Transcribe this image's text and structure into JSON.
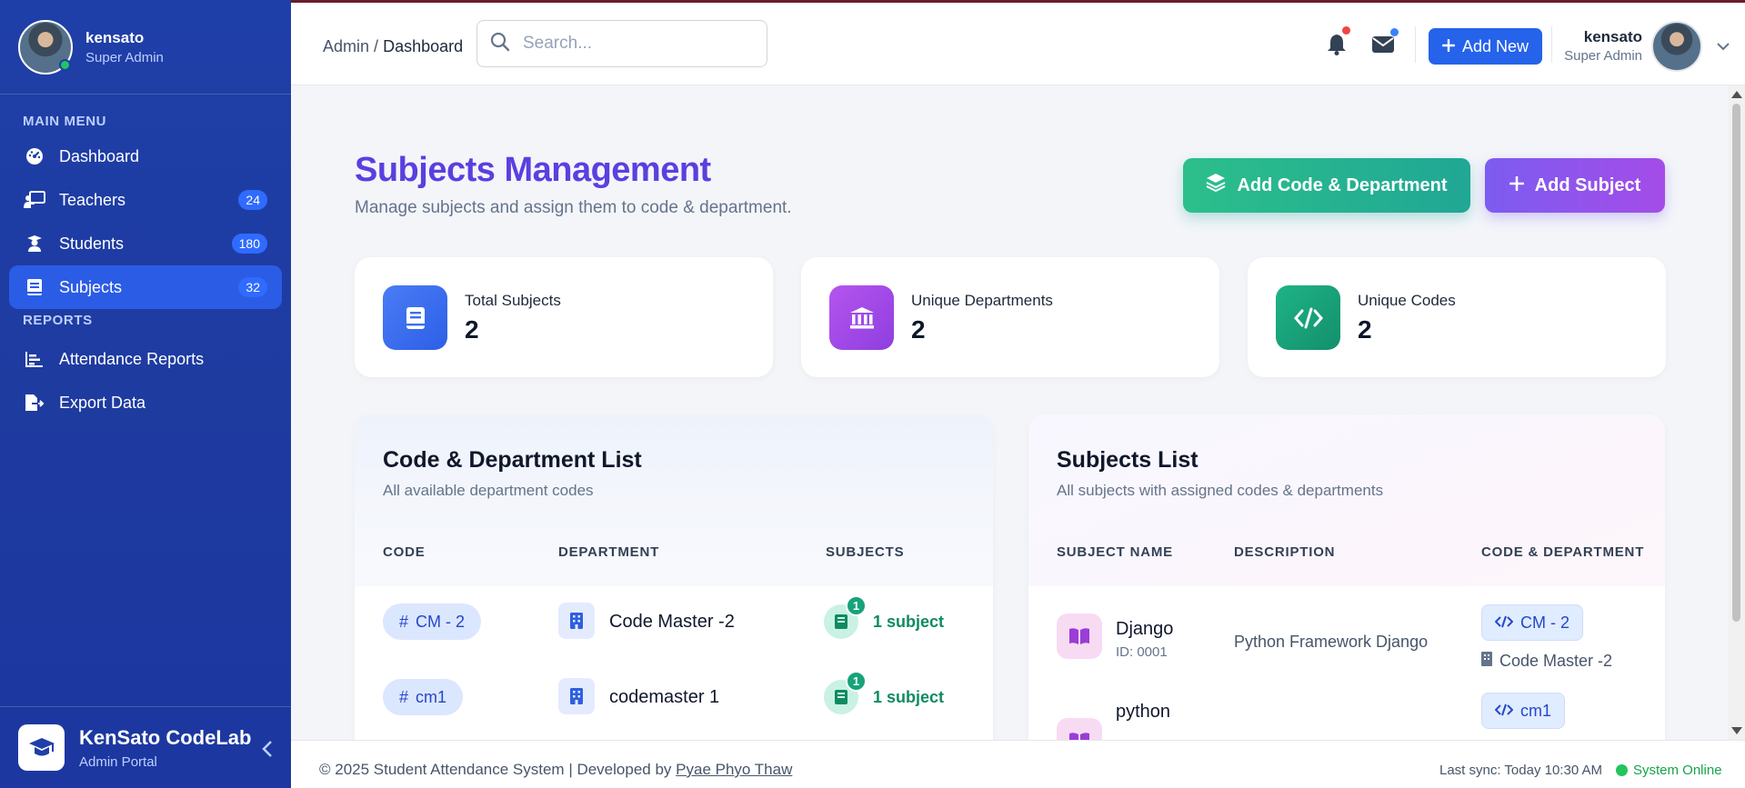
{
  "sidebar": {
    "user": {
      "name": "kensato",
      "role": "Super Admin"
    },
    "main_menu_title": "MAIN MENU",
    "reports_title": "REPORTS",
    "items": [
      {
        "label": "Dashboard",
        "icon": "gauge-icon",
        "badge": ""
      },
      {
        "label": "Teachers",
        "icon": "chalkboard-teacher-icon",
        "badge": "24"
      },
      {
        "label": "Students",
        "icon": "student-icon",
        "badge": "180"
      },
      {
        "label": "Subjects",
        "icon": "book-icon",
        "badge": "32",
        "active": true
      }
    ],
    "report_items": [
      {
        "label": "Attendance Reports",
        "icon": "chart-icon"
      },
      {
        "label": "Export Data",
        "icon": "file-export-icon"
      }
    ],
    "brand": {
      "title": "KenSato CodeLab",
      "subtitle": "Admin Portal"
    }
  },
  "topbar": {
    "breadcrumb_root": "Admin",
    "breadcrumb_sep": "/",
    "breadcrumb_current": "Dashboard",
    "search_placeholder": "Search...",
    "add_new_label": "Add New",
    "user": {
      "name": "kensato",
      "role": "Super Admin"
    },
    "notification_dot_color": "#ef4444",
    "message_dot_color": "#3b82f6"
  },
  "page": {
    "title": "Subjects Management",
    "subtitle": "Manage subjects and assign them to code & department.",
    "add_code_label": "Add Code & Department",
    "add_subject_label": "Add Subject"
  },
  "stats": [
    {
      "label": "Total Subjects",
      "value": "2",
      "icon": "book-icon",
      "color": "#3b6ff0"
    },
    {
      "label": "Unique Departments",
      "value": "2",
      "icon": "building-columns-icon",
      "color": "#a047e6"
    },
    {
      "label": "Unique Codes",
      "value": "2",
      "icon": "code-icon",
      "color": "#16a37a"
    }
  ],
  "code_panel": {
    "title": "Code & Department List",
    "subtitle": "All available department codes",
    "columns": [
      "CODE",
      "DEPARTMENT",
      "SUBJECTS"
    ],
    "rows": [
      {
        "code": "CM - 2",
        "department": "Code Master -2",
        "count": "1",
        "subjects": "1 subject"
      },
      {
        "code": "cm1",
        "department": "codemaster 1",
        "count": "1",
        "subjects": "1 subject"
      }
    ]
  },
  "subjects_panel": {
    "title": "Subjects List",
    "subtitle": "All subjects with assigned codes & departments",
    "columns": [
      "SUBJECT NAME",
      "DESCRIPTION",
      "CODE & DEPARTMENT"
    ],
    "rows": [
      {
        "name": "Django",
        "id": "ID: 0001",
        "description": "Python Framework Django",
        "code": "CM - 2",
        "department": "Code Master -2"
      },
      {
        "name": "python",
        "id": "",
        "description": "",
        "code": "cm1",
        "department": ""
      }
    ]
  },
  "footer": {
    "copyright": "© 2025 Student Attendance System | Developed by",
    "author": "Pyae Phyo Thaw",
    "sync": "Last sync: Today 10:30 AM",
    "status": "System Online"
  }
}
